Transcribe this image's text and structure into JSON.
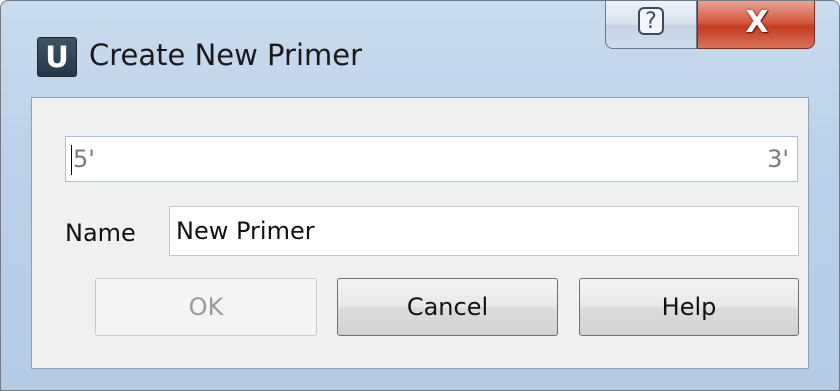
{
  "window": {
    "title": "Create New Primer",
    "app_icon_letter": "U",
    "caption_help_glyph": "?",
    "caption_close_glyph": "X"
  },
  "primer": {
    "end5_label": "5'",
    "end3_label": "3'",
    "sequence": ""
  },
  "name": {
    "label": "Name",
    "value": "New Primer"
  },
  "buttons": {
    "ok_label": "OK",
    "cancel_label": "Cancel",
    "help_label": "Help",
    "ok_enabled": false
  },
  "colors": {
    "close_button": "#c43b22",
    "titlebar": "#bcd1e8",
    "disabled_text": "#9a9a9a"
  }
}
